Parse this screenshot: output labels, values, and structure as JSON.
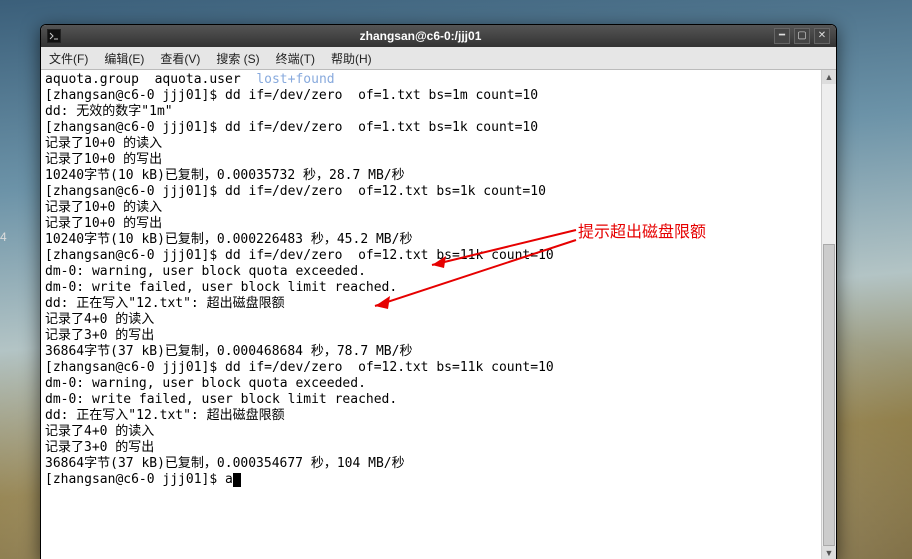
{
  "window": {
    "title": "zhangsan@c6-0:/jjj01"
  },
  "menu": {
    "file": "文件(F)",
    "edit": "编辑(E)",
    "view": "查看(V)",
    "search": "搜索 (S)",
    "terminal": "终端(T)",
    "help": "帮助(H)"
  },
  "desktop": {
    "side_label": "4"
  },
  "annotation": {
    "text": "提示超出磁盘限额"
  },
  "terminal": {
    "lost_found": "lost+found",
    "line0_a": "aquota.group  aquota.user  ",
    "line1": "[zhangsan@c6-0 jjj01]$ dd if=/dev/zero  of=1.txt bs=1m count=10",
    "line2": "dd: 无效的数字\"1m\"",
    "line3": "[zhangsan@c6-0 jjj01]$ dd if=/dev/zero  of=1.txt bs=1k count=10",
    "line4": "记录了10+0 的读入",
    "line5": "记录了10+0 的写出",
    "line6": "10240字节(10 kB)已复制，0.00035732 秒，28.7 MB/秒",
    "line7": "[zhangsan@c6-0 jjj01]$ dd if=/dev/zero  of=12.txt bs=1k count=10",
    "line8": "记录了10+0 的读入",
    "line9": "记录了10+0 的写出",
    "line10": "10240字节(10 kB)已复制，0.000226483 秒，45.2 MB/秒",
    "line11": "[zhangsan@c6-0 jjj01]$ dd if=/dev/zero  of=12.txt bs=11k count=10",
    "line12": "dm-0: warning, user block quota exceeded.",
    "line13": "dm-0: write failed, user block limit reached.",
    "line14": "dd: 正在写入\"12.txt\": 超出磁盘限额",
    "line15": "记录了4+0 的读入",
    "line16": "记录了3+0 的写出",
    "line17": "36864字节(37 kB)已复制，0.000468684 秒，78.7 MB/秒",
    "line18": "[zhangsan@c6-0 jjj01]$ dd if=/dev/zero  of=12.txt bs=11k count=10",
    "line19": "dm-0: warning, user block quota exceeded.",
    "line20": "dm-0: write failed, user block limit reached.",
    "line21": "dd: 正在写入\"12.txt\": 超出磁盘限额",
    "line22": "记录了4+0 的读入",
    "line23": "记录了3+0 的写出",
    "line24": "36864字节(37 kB)已复制，0.000354677 秒，104 MB/秒",
    "prompt": "[zhangsan@c6-0 jjj01]$ ",
    "typed": "a"
  }
}
